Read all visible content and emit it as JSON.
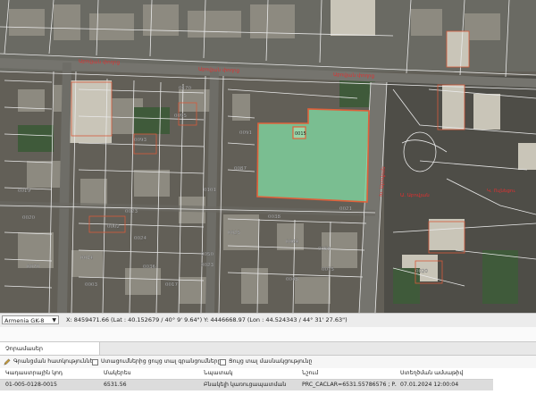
{
  "map": {
    "parcel_labels": [
      "0170",
      "0095",
      "0093",
      "0091",
      "0087",
      "0101",
      "0023",
      "0019",
      "0020",
      "0002",
      "0064",
      "0058",
      "0048",
      "0087",
      "0101",
      "0034",
      "0036",
      "0025",
      "0070",
      "0075",
      "0050"
    ],
    "selected_parcel_label": "0015",
    "small_labels": [
      "0050",
      "0023",
      "0020",
      "0024",
      "0038",
      "0021",
      "0019",
      "0017",
      "0003"
    ],
    "colors": {
      "selected_fill": "#7fcf9b",
      "selected_stroke": "#e0603a",
      "road": "#6e6e68",
      "parcel_line": "#e8e8e8",
      "street_label": "#e03030"
    }
  },
  "coordbar": {
    "crs": "Armenia GK-8",
    "coords": "X: 8459471.66 (Lat : 40.152679 / 40° 9' 9.64\")  Y: 4446668.97 (Lon : 44.524343 / 44° 31' 27.63\")"
  },
  "panel": {
    "tab_label": "Չորամասեր",
    "tools": {
      "edit": "Գրանցման հատկություններ",
      "show_selected": "Ստացումներից ցույց տալ գրանցումները",
      "show_all": "Ցույց տալ մասնակցությունը"
    },
    "columns": [
      "Կադաստրային կոդ",
      "Մակերես",
      "Նպատակ",
      "Նշում",
      "Ստեղծման ամսաթիվ"
    ],
    "rows": [
      [
        "01-005-0128-0015",
        "6531.56",
        "Բնակելի կառուցապատման",
        "PRC_CACLAR=6531.55786576 ; P...",
        "07.01.2024 12:00:04"
      ]
    ]
  }
}
